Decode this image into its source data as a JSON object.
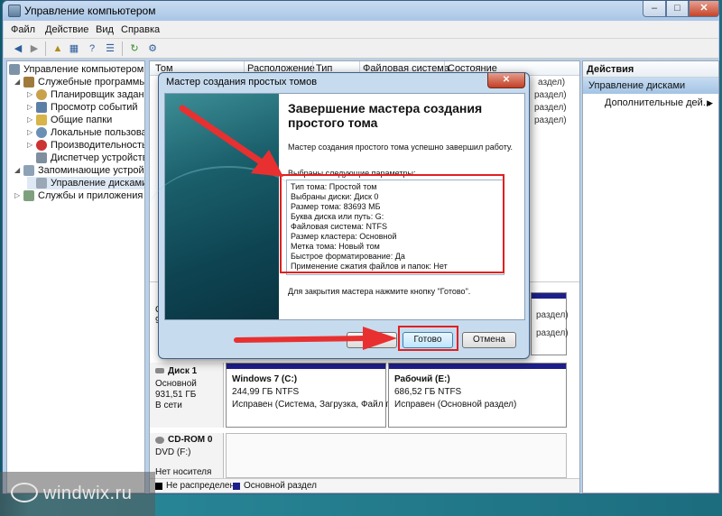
{
  "window": {
    "title": "Управление компьютером"
  },
  "menu": [
    "Файл",
    "Действие",
    "Вид",
    "Справка"
  ],
  "toolbar_icons": [
    "back-icon",
    "forward-icon",
    "up-icon",
    "properties-icon",
    "help-icon",
    "details-icon",
    "refresh-icon",
    "export-icon"
  ],
  "tree": {
    "root": "Управление компьютером (л",
    "utilities": "Служебные программы",
    "scheduler": "Планировщик заданий",
    "events": "Просмотр событий",
    "shared": "Общие папки",
    "users": "Локальные пользовате",
    "perf": "Производительность",
    "devmgr": "Диспетчер устройств",
    "storage": "Запоминающие устройст",
    "diskmgmt": "Управление дисками",
    "services": "Службы и приложения"
  },
  "volumes": {
    "columns": [
      "Том",
      "Расположение",
      "Тип",
      "Файловая система",
      "Состояние"
    ],
    "row_tails": [
      "аздел)",
      "раздел)",
      "раздел)",
      "раздел)"
    ]
  },
  "disks": {
    "disk1": {
      "name": "Диск 1",
      "type": "Основной",
      "size": "931,51 ГБ",
      "status": "В сети"
    },
    "disk0_frag": {
      "letter": "О",
      "num": "9"
    },
    "part_c": {
      "title": "Windows 7  (C:)",
      "size": "244,99 ГБ NTFS",
      "status": "Исправен (Система, Загрузка, Файл по"
    },
    "part_e": {
      "title": "Рабочий  (E:)",
      "size": "686,52 ГБ NTFS",
      "status": "Исправен (Основной раздел)"
    },
    "cdrom": {
      "name": "CD-ROM 0",
      "type": "DVD (F:)",
      "status": "Нет носителя"
    },
    "right_tails": [
      "",
      "раздел)",
      "",
      "раздел)"
    ]
  },
  "legend": {
    "unallocated": "Не распределен",
    "primary": "Основной раздел"
  },
  "actions": {
    "header": "Действия",
    "section": "Управление дисками",
    "more": "Дополнительные дей..."
  },
  "dialog": {
    "title": "Мастер создания простых томов",
    "heading": "Завершение мастера создания простого тома",
    "intro": "Мастер создания простого тома успешно завершил работу.",
    "params_label": "Выбраны следующие параметры:",
    "params": [
      "Тип тома: Простой том",
      "Выбраны диски: Диск 0",
      "Размер тома: 83693 МБ",
      "Буква диска или путь: G:",
      "Файловая система: NTFS",
      "Размер кластера: Основной",
      "Метка тома: Новый том",
      "Быстрое форматирование: Да",
      "Применение сжатия файлов и папок: Нет"
    ],
    "close_hint": "Для закрытия мастера нажмите кнопку \"Готово\".",
    "finish": "Готово",
    "cancel": "Отмена"
  },
  "watermark": "windwix.ru",
  "colors": {
    "highlight": "#e02020",
    "partition_bar": "#1e1e8a",
    "dialog_banner": "#0e4452"
  }
}
